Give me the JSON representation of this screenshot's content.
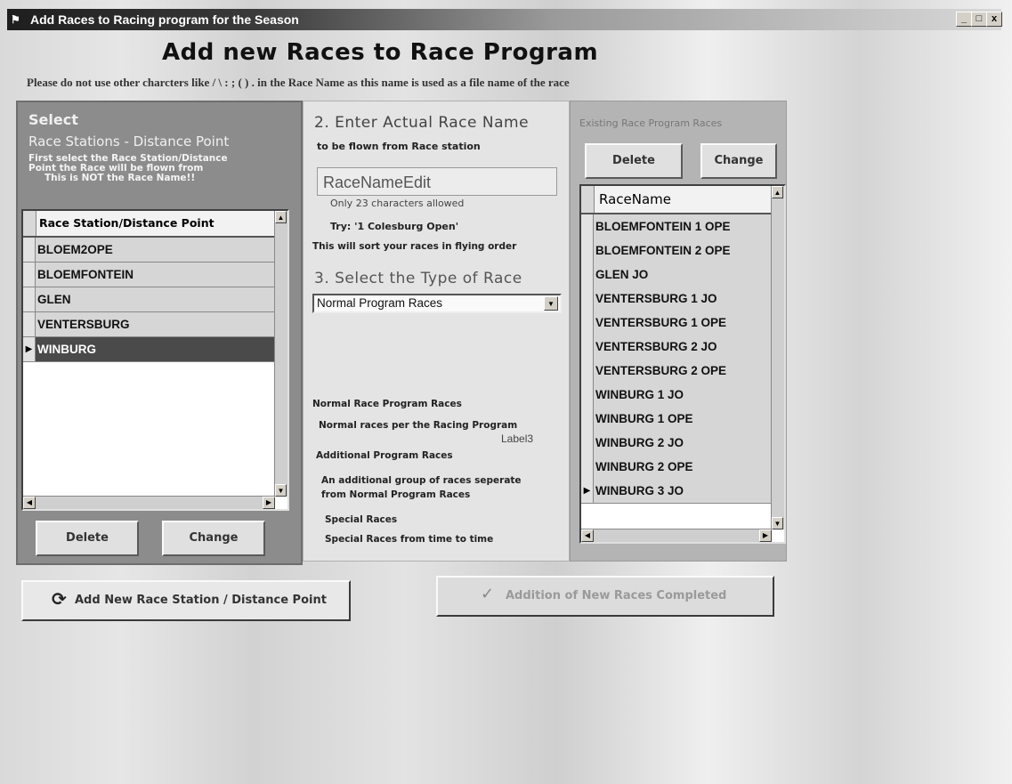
{
  "window": {
    "title": "Add Races to Racing program for the Season",
    "app_icon": "app-icon",
    "controls": [
      "_",
      "□",
      "x"
    ]
  },
  "heading": "Add new Races to Race Program",
  "warning": "Please do not use other charcters like / \\ : ; ( ) . in the Race Name as this name is used as a file name of the race",
  "left_panel": {
    "select_label": "Select",
    "heading": "Race Stations  -  Distance Point",
    "instructions": [
      "First select the Race Station/Distance",
      "Point the Race will be flown from",
      "This is NOT the Race Name!!"
    ],
    "grid": {
      "header": "Race Station/Distance Point",
      "rows": [
        "BLOEM2OPE",
        "BLOEMFONTEIN",
        "GLEN",
        "VENTERSBURG",
        "WINBURG"
      ],
      "selected_index": 4
    },
    "delete_label": "Delete",
    "change_label": "Change"
  },
  "middle_panel": {
    "step2_label": "2.  Enter Actual Race Name",
    "step2_sub": "to be flown from Race station",
    "race_name_value": "RaceNameEdit",
    "char_note": "Only 23 characters allowed",
    "try_hint": "Try: '1 Colesburg Open'",
    "sort_hint": "This will sort your races in flying order",
    "step3_label": "3.  Select the Type of Race",
    "race_type_selected": "Normal Program Races",
    "descriptions": {
      "normal_title": "Normal Race Program Races",
      "normal_desc": "Normal races per the Racing Program",
      "label3": "Label3",
      "additional_title": "Additional Program Races",
      "additional_desc_1": "An additional group of races seperate",
      "additional_desc_2": "from Normal Program Races",
      "special_title": "Special Races",
      "special_desc": "Special Races from time to time"
    }
  },
  "right_panel": {
    "caption": "Existing Race Program Races",
    "delete_label": "Delete",
    "change_label": "Change",
    "grid": {
      "header": "RaceName",
      "rows": [
        "BLOEMFONTEIN 1 OPE",
        "BLOEMFONTEIN 2 OPE",
        "GLEN JO",
        "VENTERSBURG 1 JO",
        "VENTERSBURG 1 OPE",
        "VENTERSBURG 2 JO",
        "VENTERSBURG 2 OPE",
        "WINBURG 1 JO",
        "WINBURG 1 OPE",
        "WINBURG 2 JO",
        "WINBURG 2 OPE",
        "WINBURG 3 JO"
      ],
      "selected_index": 11
    }
  },
  "bottom": {
    "add_station_label": "Add New Race Station / Distance Point",
    "completed_label": "Addition of New Races Completed"
  }
}
